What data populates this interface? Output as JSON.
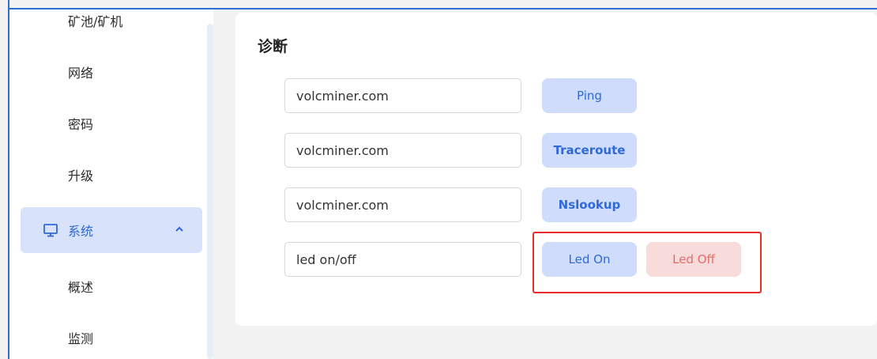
{
  "sidebar": {
    "items": [
      {
        "label": "矿池/矿机"
      },
      {
        "label": "网络"
      },
      {
        "label": "密码"
      },
      {
        "label": "升级"
      },
      {
        "label": "系统",
        "icon": "monitor-icon",
        "expanded": true
      },
      {
        "label": "概述"
      },
      {
        "label": "监测"
      }
    ]
  },
  "diagnostics": {
    "title": "诊断",
    "rows": [
      {
        "input_value": "volcminer.com",
        "buttons": [
          {
            "label": "Ping"
          }
        ]
      },
      {
        "input_value": "volcminer.com",
        "buttons": [
          {
            "label": "Traceroute"
          }
        ]
      },
      {
        "input_value": "volcminer.com",
        "buttons": [
          {
            "label": "Nslookup"
          }
        ]
      },
      {
        "input_value": "led on/off",
        "buttons": [
          {
            "label": "Led On"
          },
          {
            "label": "Led Off"
          }
        ]
      }
    ]
  },
  "colors": {
    "accent": "#2f6ad8",
    "active_bg": "#d8e3fb",
    "button_blue_bg": "#cfdcfc",
    "button_red_bg": "#f8dcdc",
    "button_red_text": "#e26a6a",
    "highlight_border": "#e52b2b"
  }
}
